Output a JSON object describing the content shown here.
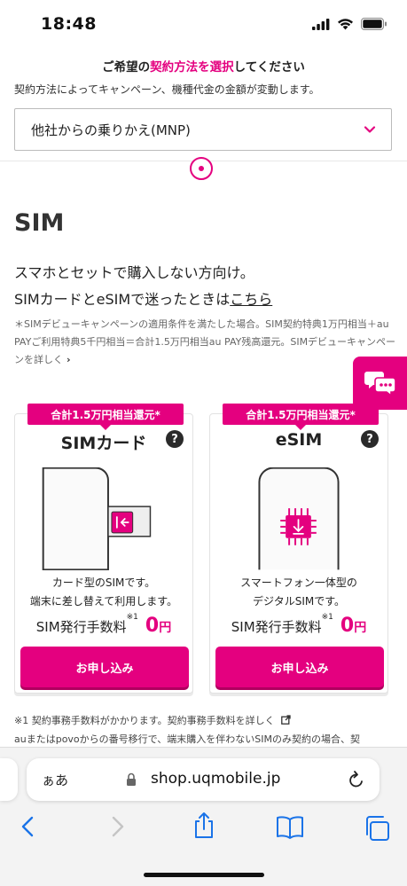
{
  "status_bar": {
    "time": "18:48"
  },
  "contract": {
    "heading_pre": "ご希望の",
    "heading_highlight": "契約方法を選択",
    "heading_post": "してください",
    "subtitle": "契約方法によってキャンペーン、機種代金の金額が変動します。",
    "selected_option": "他社からの乗りかえ(MNP)"
  },
  "section": {
    "title": "SIM",
    "desc_line1": "スマホとセットで購入しない方向け。",
    "desc_line2_pre": "SIMカードとeSIMで迷ったときは",
    "desc_line2_link": "こちら",
    "note_text": "＊SIMデビューキャンペーンの適用条件を満たした場合。SIM契約特典1万円相当＋au PAYご利用特典5千円相当＝合計1.5万円相当au PAY残高還元。SIMデビューキャンペーンを詳しく",
    "note_arrow": "›"
  },
  "cards": [
    {
      "badge": "合計1.5万円相当還元*",
      "title": "SIMカード",
      "help": "?",
      "desc_line1": "カード型のSIMです。",
      "desc_line2": "端末に差し替えて利用します。",
      "fee_label": "SIM発行手数料",
      "fee_note": "※1",
      "fee_value": "0",
      "fee_unit": "円",
      "button": "お申し込み"
    },
    {
      "badge": "合計1.5万円相当還元*",
      "title": "eSIM",
      "help": "?",
      "desc_line1": "スマートフォン一体型の",
      "desc_line2": "デジタルSIMです。",
      "fee_label": "SIM発行手数料",
      "fee_note": "※1",
      "fee_value": "0",
      "fee_unit": "円",
      "button": "お申し込み"
    }
  ],
  "footnotes": {
    "line1": "※1 契約事務手数料がかかります。契約事務手数料を詳しく",
    "line2": "auまたはpovoからの番号移行で、端末購入を伴わないSIMのみ契約の場合、契"
  },
  "browser": {
    "aa_label": "ぁあ",
    "url": "shop.uqmobile.jp"
  },
  "colors": {
    "accent": "#e4007f"
  }
}
